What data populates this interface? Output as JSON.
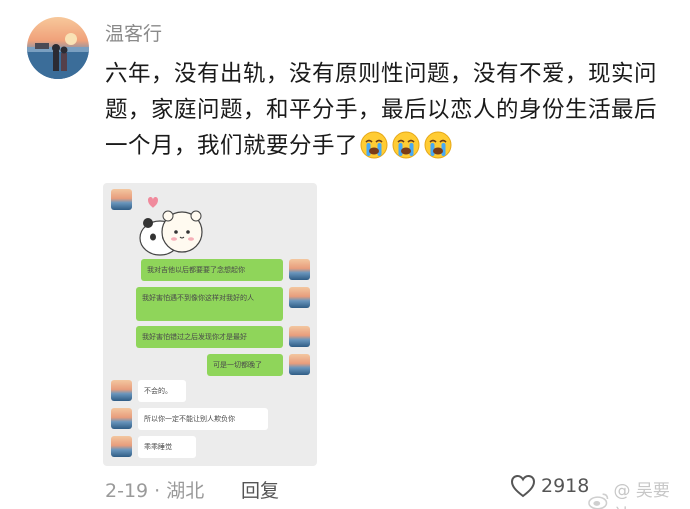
{
  "post": {
    "username": "温客行",
    "text": "六年，没有出轨，没有原则性问题，没有不爱，现实问题，家庭问题，和平分手，最后以恋人的身份生活最后一个月，我们就要分手了",
    "emojis": [
      "crying-face-icon",
      "crying-face-icon",
      "crying-face-icon"
    ]
  },
  "chat_image": {
    "messages": [
      {
        "side": "right",
        "color": "green",
        "text": "我对吉他以后都要要了念想起你"
      },
      {
        "side": "right",
        "color": "green",
        "text": "我好害怕遇不到像你这样对我好的人"
      },
      {
        "side": "right",
        "color": "green",
        "text": "我好害怕错过之后发现你才是最好"
      },
      {
        "side": "right",
        "color": "green",
        "text": "可是一切都晚了"
      },
      {
        "side": "left",
        "color": "white",
        "text": "不会的。"
      },
      {
        "side": "left",
        "color": "white",
        "text": "所以你一定不能让别人欺负你"
      },
      {
        "side": "left",
        "color": "white",
        "text": "乖乖睡觉"
      }
    ]
  },
  "footer": {
    "date_location": "2-19 · 湖北",
    "reply_label": "回复",
    "like_count": "2918",
    "watermark": "@ 吴要社"
  }
}
